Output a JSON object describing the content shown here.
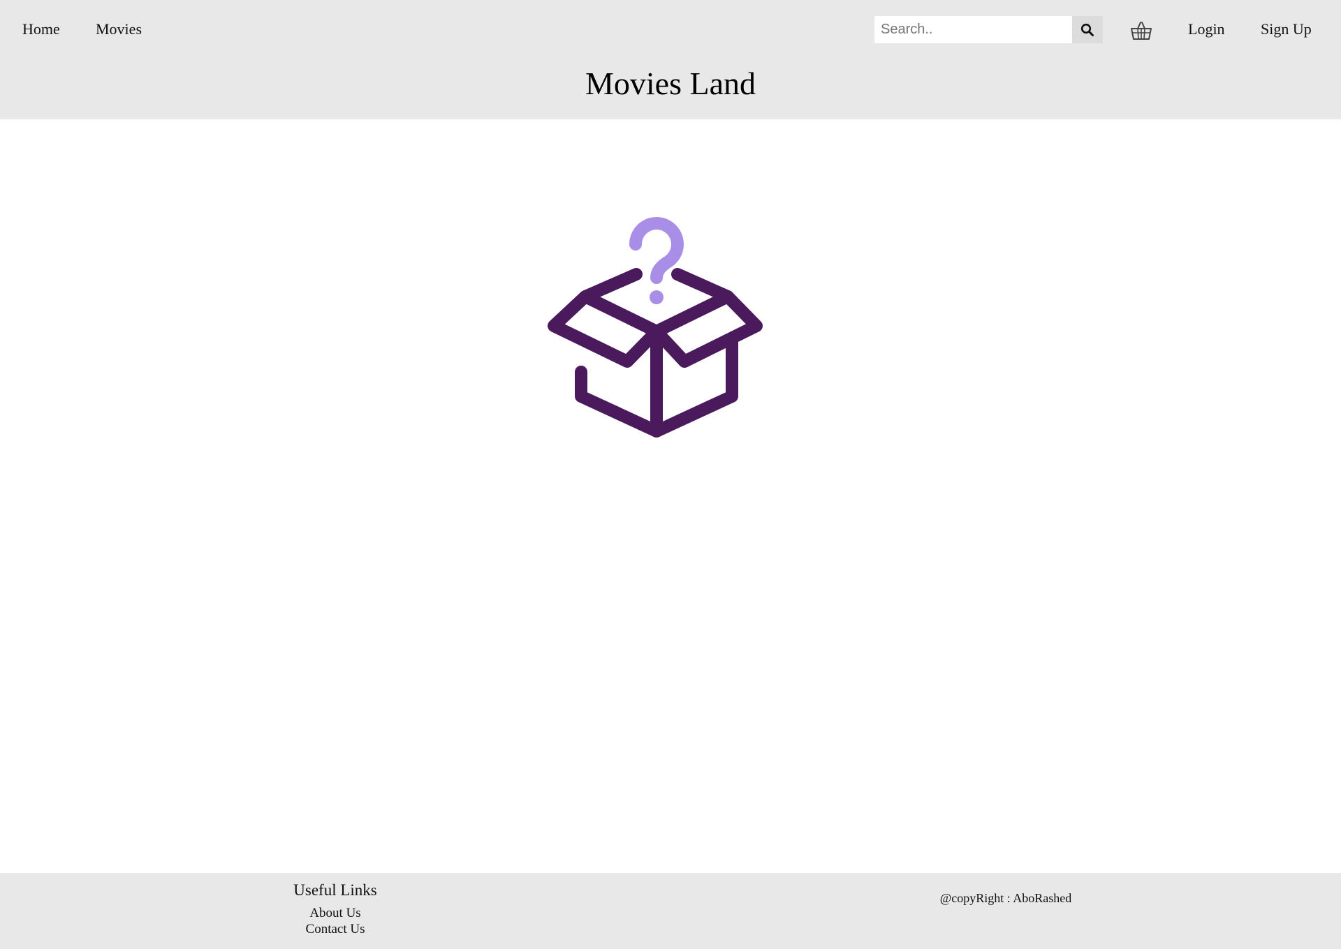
{
  "header": {
    "nav": {
      "home": "Home",
      "movies": "Movies"
    },
    "search": {
      "placeholder": "Search..",
      "value": "",
      "button_icon": "search-icon"
    },
    "cart_icon": "shopping-basket-icon",
    "auth": {
      "login": "Login",
      "signup": "Sign Up"
    },
    "site_title": "Movies Land"
  },
  "main": {
    "illustration_icon": "empty-box-question-icon",
    "colors": {
      "box": "#4a1a5c",
      "question_mark": "#a98ee8"
    }
  },
  "footer": {
    "useful_links": {
      "heading": "Useful Links",
      "links": [
        "About Us",
        "Contact Us"
      ]
    },
    "copyright": "@copyRight : AboRashed"
  },
  "colors": {
    "header_bg": "#e8e8e8",
    "footer_bg": "#e8e8e8",
    "search_button_bg": "#dcdcdc"
  }
}
